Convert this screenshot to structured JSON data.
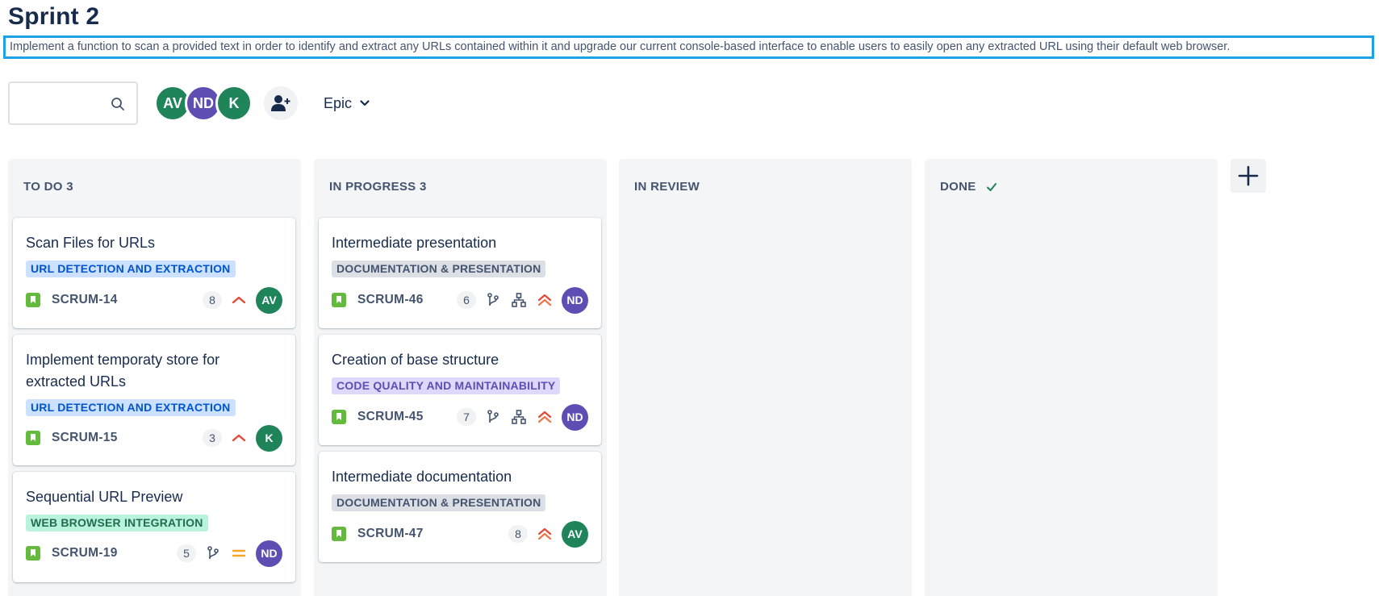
{
  "sprint": {
    "title": "Sprint 2",
    "goal": "Implement a function to scan a provided text in order to identify and extract any URLs contained within it and upgrade our current console-based interface to enable users to easily open any extracted URL using their default web browser."
  },
  "toolbar": {
    "search": {
      "value": "",
      "placeholder": "",
      "icon": "search-icon"
    },
    "avatars": [
      {
        "initials": "AV",
        "color": "#1f845a"
      },
      {
        "initials": "ND",
        "color": "#5e4db2"
      },
      {
        "initials": "K",
        "color": "#1f845a"
      }
    ],
    "add_user_icon": "add-user-icon",
    "epic_filter": {
      "label": "Epic",
      "icon": "chevron-down-icon"
    }
  },
  "columns": [
    {
      "title": "TO DO 3",
      "cards": [
        {
          "title": "Scan Files for URLs",
          "epic": "URL DETECTION AND EXTRACTION",
          "epic_style": "blue",
          "key": "SCRUM-14",
          "points": "8",
          "priority": "high",
          "assignee": "AV",
          "assignee_color": "#1f845a"
        },
        {
          "title": "Implement temporaty store for extracted URLs",
          "epic": "URL DETECTION AND EXTRACTION",
          "epic_style": "blue",
          "key": "SCRUM-15",
          "points": "3",
          "priority": "high",
          "assignee": "K",
          "assignee_color": "#1f845a"
        },
        {
          "title": "Sequential URL Preview",
          "epic": "WEB BROWSER INTEGRATION",
          "epic_style": "green",
          "key": "SCRUM-19",
          "points": "5",
          "branch": true,
          "priority": "medium",
          "assignee": "ND",
          "assignee_color": "#5e4db2"
        }
      ]
    },
    {
      "title": "IN PROGRESS 3",
      "cards": [
        {
          "title": "Intermediate presentation",
          "epic": "DOCUMENTATION & PRESENTATION",
          "epic_style": "grey",
          "key": "SCRUM-46",
          "points": "6",
          "branch": true,
          "subtasks": true,
          "priority": "highest",
          "assignee": "ND",
          "assignee_color": "#5e4db2"
        },
        {
          "title": "Creation of base structure",
          "epic": "CODE QUALITY AND MAINTAINABILITY",
          "epic_style": "purple",
          "key": "SCRUM-45",
          "points": "7",
          "branch": true,
          "subtasks": true,
          "priority": "highest",
          "assignee": "ND",
          "assignee_color": "#5e4db2"
        },
        {
          "title": "Intermediate documentation",
          "epic": "DOCUMENTATION & PRESENTATION",
          "epic_style": "grey",
          "key": "SCRUM-47",
          "points": "8",
          "priority": "highest",
          "assignee": "AV",
          "assignee_color": "#1f845a"
        }
      ]
    },
    {
      "title": "IN REVIEW",
      "cards": []
    },
    {
      "title": "DONE",
      "done_icon": "check-icon",
      "cards": []
    }
  ],
  "add_column_icon": "plus-icon",
  "colors": {
    "accent_border": "#1ba3e6",
    "priority_high": "#e34935",
    "priority_medium": "#f5a623",
    "story_icon": "#63ba3c",
    "done_check": "#1f845a"
  }
}
